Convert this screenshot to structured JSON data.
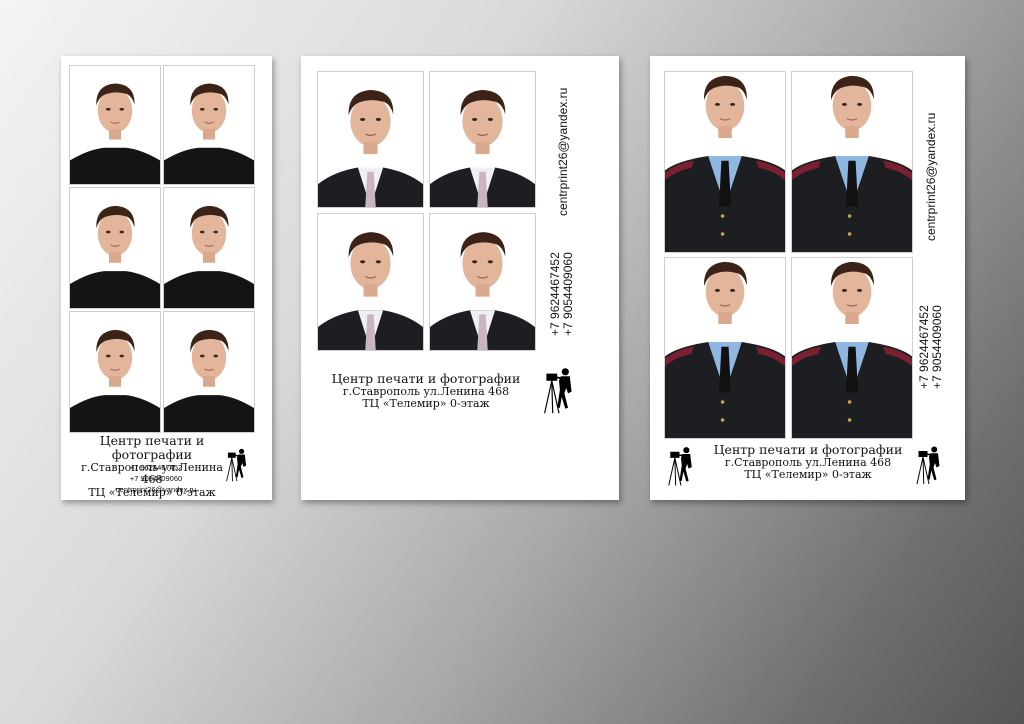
{
  "studio": {
    "title": "Центр печати и фотографии",
    "address": "г.Ставрополь ул.Ленина 468",
    "mall": "ТЦ «Телемир» 0-этаж",
    "phone1": "+7 9624467452",
    "phone2": "+7 9054409060",
    "email": "centrprint26@yandex.ru"
  },
  "colors": {
    "sweater": "#141414",
    "suit": "#1c1e22",
    "shirt_white": "#eef0f3",
    "shirt_blue": "#8fb7e2",
    "tie_pink": "#c9b4c4",
    "hair": "#3b2417",
    "skin": "#e3b59a"
  },
  "icons": [
    "photographer-with-tripod-icon"
  ]
}
